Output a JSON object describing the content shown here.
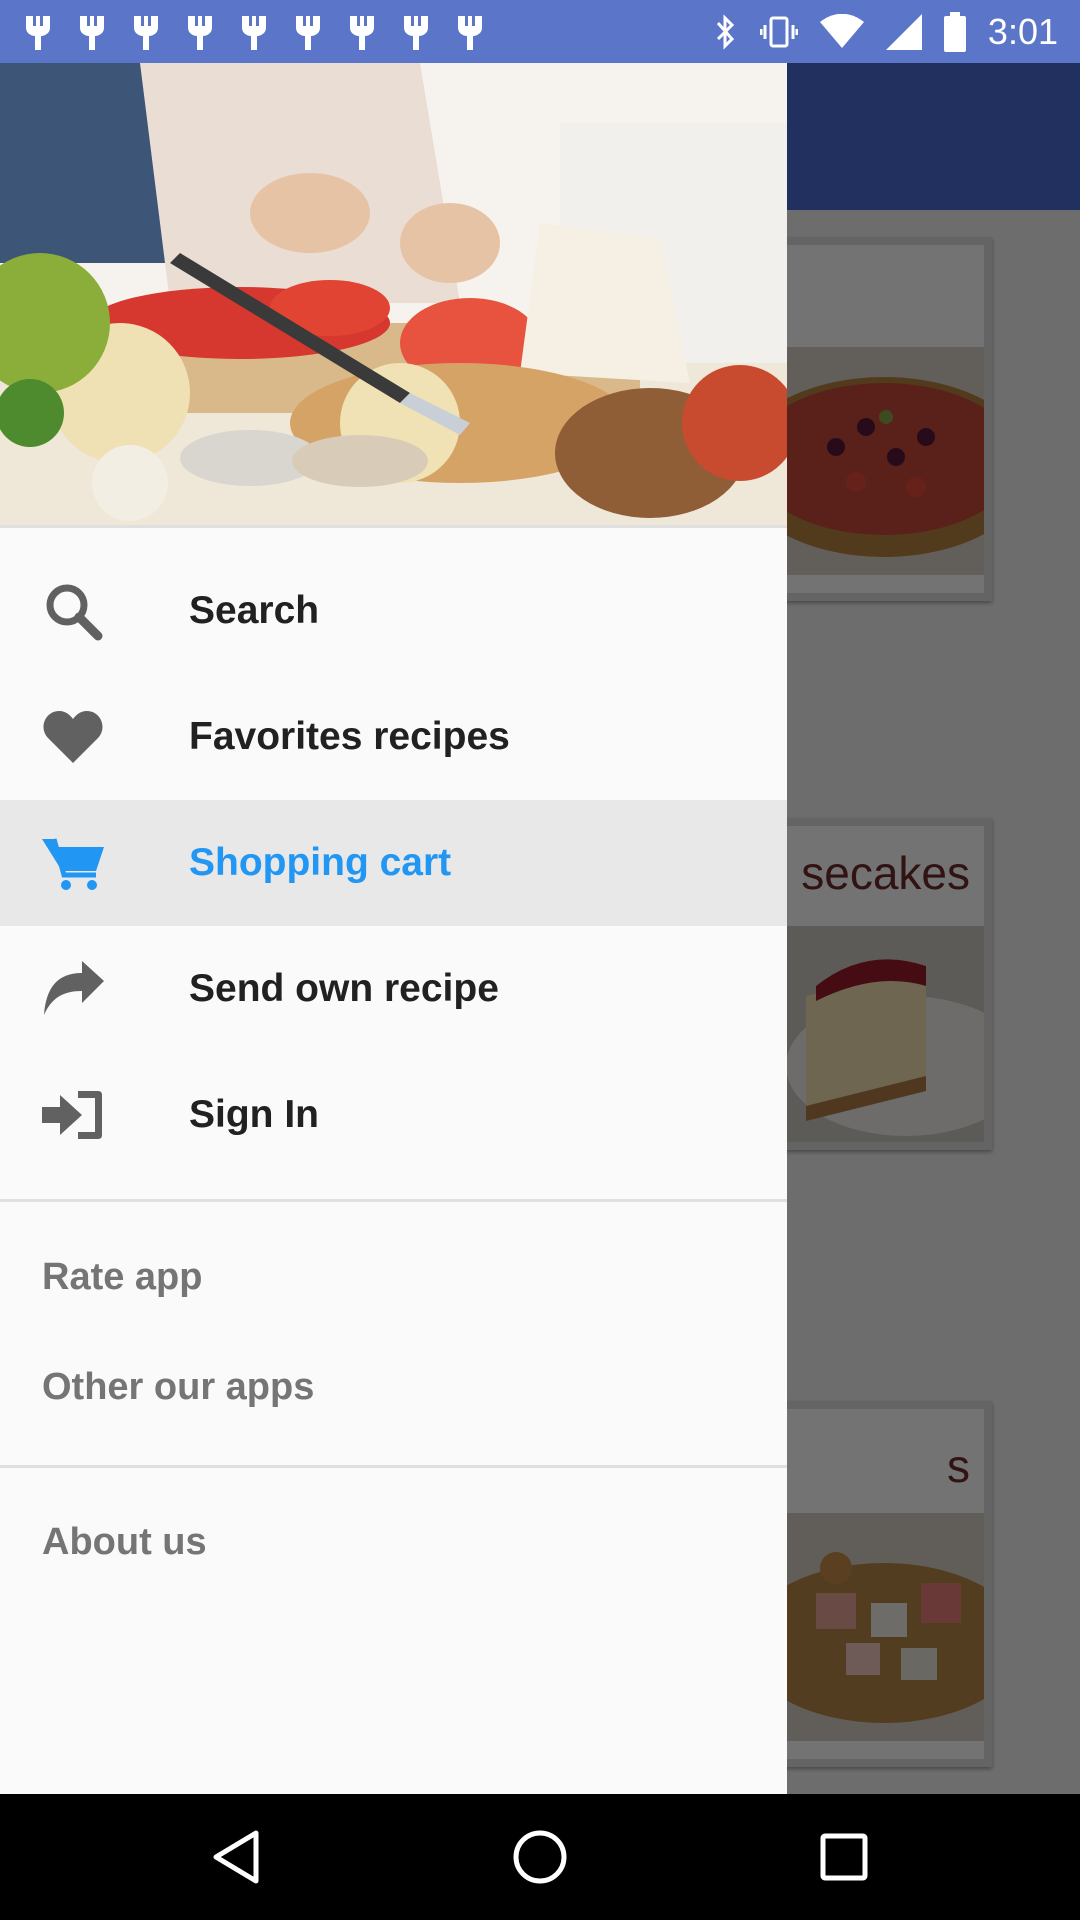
{
  "status_bar": {
    "time": "3:01",
    "notification_icons": [
      "cutlery-app-icon",
      "cutlery-app-icon",
      "cutlery-app-icon",
      "cutlery-app-icon",
      "cutlery-app-icon",
      "cutlery-app-icon",
      "cutlery-app-icon",
      "cutlery-app-icon",
      "cutlery-app-icon"
    ],
    "system_icons": [
      "bluetooth-icon",
      "vibrate-icon",
      "wifi-icon",
      "signal-icon",
      "battery-icon"
    ]
  },
  "background_app": {
    "cards": [
      {
        "title": ""
      },
      {
        "title": "secakes"
      },
      {
        "title": "s"
      }
    ]
  },
  "drawer": {
    "menu": [
      {
        "icon": "search-icon",
        "label": "Search",
        "active": false
      },
      {
        "icon": "heart-icon",
        "label": "Favorites recipes",
        "active": false
      },
      {
        "icon": "cart-icon",
        "label": "Shopping cart",
        "active": true
      },
      {
        "icon": "share-icon",
        "label": "Send own recipe",
        "active": false
      },
      {
        "icon": "sign-in-icon",
        "label": "Sign In",
        "active": false
      }
    ],
    "secondary": [
      {
        "label": "Rate app"
      },
      {
        "label": "Other our apps"
      },
      {
        "label": "About us"
      }
    ]
  },
  "colors": {
    "status_bar": "#5b75c9",
    "toolbar": "#4a6cd3",
    "active_accent": "#2196f3",
    "icon_gray": "#616161"
  },
  "nav_bar": {
    "buttons": [
      "back-icon",
      "home-icon",
      "recents-icon"
    ]
  }
}
